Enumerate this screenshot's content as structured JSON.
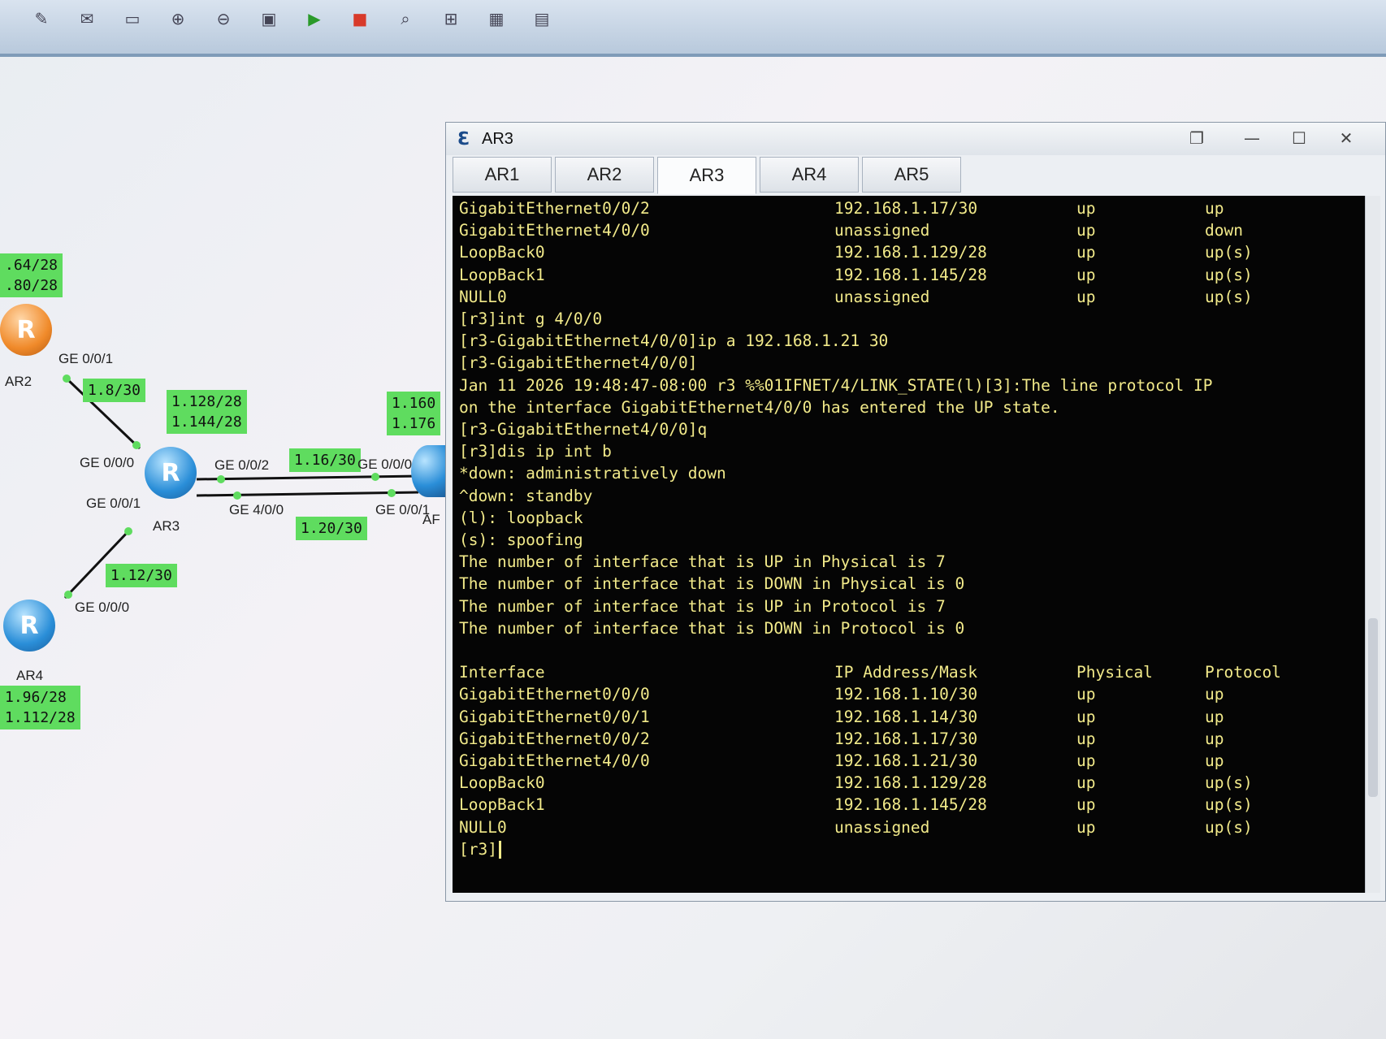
{
  "toolbar": {
    "buttons": [
      "delete-icon",
      "comment-icon",
      "rectangle-icon",
      "zoom-in-icon",
      "zoom-out-icon",
      "fit-icon",
      "start-icon",
      "stop-icon",
      "capture-icon",
      "topology-icon",
      "grid-icon",
      "console-icon"
    ],
    "glyphs": [
      "✎",
      "✉",
      "▭",
      "⊕",
      "⊖",
      "▣",
      "▶",
      "■",
      "⌕",
      "⊞",
      "▦",
      "▤"
    ]
  },
  "topology": {
    "routers": {
      "ar2": "AR2",
      "ar3": "AR3",
      "ar4": "AR4",
      "ar5_partial": "AF"
    },
    "router_glyph": "R",
    "ports": {
      "ar2_ge001": "GE 0/0/1",
      "ar3_ge000": "GE 0/0/0",
      "ar3_ge001": "GE 0/0/1",
      "ar3_ge002": "GE 0/0/2",
      "ar3_ge400": "GE 4/0/0",
      "ar5_ge000": "GE 0/0/0",
      "ar5_ge001": "GE 0/0/1",
      "ar4_ge000": "GE 0/0/0"
    },
    "nets": {
      "ar2_lo": [
        ".64/28",
        ".80/28"
      ],
      "link_ar2_ar3": "1.8/30",
      "ar3_lo": [
        "1.128/28",
        "1.144/28"
      ],
      "ar5_lo": [
        "1.160",
        "1.176"
      ],
      "link_ar3_ar5_a": "1.16/30",
      "link_ar3_ar5_b": "1.20/30",
      "link_ar3_ar4": "1.12/30",
      "ar4_lo": [
        "1.96/28",
        "1.112/28"
      ]
    }
  },
  "console": {
    "title": "AR3",
    "tabs": [
      "AR1",
      "AR2",
      "AR3",
      "AR4",
      "AR5"
    ],
    "active_tab": "AR3",
    "window_buttons": [
      "restore-icon",
      "minimize-icon",
      "maximize-icon",
      "close-icon"
    ],
    "window_glyphs": [
      "❐",
      "—",
      "☐",
      "✕"
    ],
    "top_table": [
      [
        "GigabitEthernet0/0/2",
        "192.168.1.17/30",
        "up",
        "up"
      ],
      [
        "GigabitEthernet4/0/0",
        "unassigned",
        "up",
        "down"
      ],
      [
        "LoopBack0",
        "192.168.1.129/28",
        "up",
        "up(s)"
      ],
      [
        "LoopBack1",
        "192.168.1.145/28",
        "up",
        "up(s)"
      ],
      [
        "NULL0",
        "unassigned",
        "up",
        "up(s)"
      ]
    ],
    "log_lines": [
      "[r3]int g 4/0/0",
      "[r3-GigabitEthernet4/0/0]ip a 192.168.1.21 30",
      "[r3-GigabitEthernet4/0/0]",
      "Jan 11 2026 19:48:47-08:00 r3 %%01IFNET/4/LINK_STATE(l)[3]:The line protocol IP",
      "on the interface GigabitEthernet4/0/0 has entered the UP state.",
      "[r3-GigabitEthernet4/0/0]q",
      "[r3]dis ip int b",
      "*down: administratively down",
      "^down: standby",
      "(l): loopback",
      "(s): spoofing",
      "The number of interface that is UP in Physical is 7",
      "The number of interface that is DOWN in Physical is 0",
      "The number of interface that is UP in Protocol is 7",
      "The number of interface that is DOWN in Protocol is 0"
    ],
    "table_header": [
      "Interface",
      "IP Address/Mask",
      "Physical",
      "Protocol"
    ],
    "bottom_table": [
      [
        "GigabitEthernet0/0/0",
        "192.168.1.10/30",
        "up",
        "up"
      ],
      [
        "GigabitEthernet0/0/1",
        "192.168.1.14/30",
        "up",
        "up"
      ],
      [
        "GigabitEthernet0/0/2",
        "192.168.1.17/30",
        "up",
        "up"
      ],
      [
        "GigabitEthernet4/0/0",
        "192.168.1.21/30",
        "up",
        "up"
      ],
      [
        "LoopBack0",
        "192.168.1.129/28",
        "up",
        "up(s)"
      ],
      [
        "LoopBack1",
        "192.168.1.145/28",
        "up",
        "up(s)"
      ],
      [
        "NULL0",
        "unassigned",
        "up",
        "up(s)"
      ]
    ],
    "prompt": "[r3]"
  }
}
